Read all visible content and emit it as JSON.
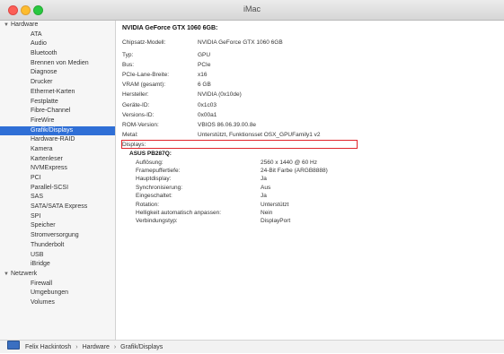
{
  "window": {
    "title": "iMac"
  },
  "sidebar": {
    "items": [
      {
        "type": "group",
        "label": "Hardware",
        "expanded": true
      },
      {
        "type": "item",
        "label": "ATA"
      },
      {
        "type": "item",
        "label": "Audio"
      },
      {
        "type": "item",
        "label": "Bluetooth"
      },
      {
        "type": "item",
        "label": "Brennen von Medien"
      },
      {
        "type": "item",
        "label": "Diagnose"
      },
      {
        "type": "item",
        "label": "Drucker"
      },
      {
        "type": "item",
        "label": "Ethernet-Karten"
      },
      {
        "type": "item",
        "label": "Festplatte"
      },
      {
        "type": "item",
        "label": "Fibre-Channel"
      },
      {
        "type": "item",
        "label": "FireWire"
      },
      {
        "type": "item",
        "label": "Grafik/Displays",
        "selected": true
      },
      {
        "type": "item",
        "label": "Hardware-RAID"
      },
      {
        "type": "item",
        "label": "Kamera"
      },
      {
        "type": "item",
        "label": "Kartenleser"
      },
      {
        "type": "item",
        "label": "NVMExpress"
      },
      {
        "type": "item",
        "label": "PCI"
      },
      {
        "type": "item",
        "label": "Parallel-SCSI"
      },
      {
        "type": "item",
        "label": "SAS"
      },
      {
        "type": "item",
        "label": "SATA/SATA Express"
      },
      {
        "type": "item",
        "label": "SPI"
      },
      {
        "type": "item",
        "label": "Speicher"
      },
      {
        "type": "item",
        "label": "Stromversorgung"
      },
      {
        "type": "item",
        "label": "Thunderbolt"
      },
      {
        "type": "item",
        "label": "USB"
      },
      {
        "type": "item",
        "label": "iBridge"
      },
      {
        "type": "group",
        "label": "Netzwerk",
        "expanded": true
      },
      {
        "type": "item",
        "label": "Firewall"
      },
      {
        "type": "item",
        "label": "Umgebungen"
      },
      {
        "type": "item",
        "label": "Volumes"
      }
    ]
  },
  "detail": {
    "heading": "NVIDIA GeForce GTX 1060 6GB:",
    "properties": [
      {
        "key": "Chipsatz-Modell:",
        "value": "NVIDIA GeForce GTX 1060 6GB"
      },
      {
        "key": "Typ:",
        "value": "GPU"
      },
      {
        "key": "Bus:",
        "value": "PCIe"
      },
      {
        "key": "PCIe-Lane-Breite:",
        "value": "x16"
      },
      {
        "key": "VRAM (gesamt):",
        "value": "6 GB"
      },
      {
        "key": "Hersteller:",
        "value": "NVIDIA (0x10de)"
      },
      {
        "key": "Geräte-ID:",
        "value": "0x1c03"
      },
      {
        "key": "Versions-ID:",
        "value": "0x00a1"
      },
      {
        "key": "ROM-Version:",
        "value": "VBIOS 86.06.39.00.8e"
      },
      {
        "key": "Metal:",
        "value": "Unterstützt, Funktionsset OSX_GPUFamily1 v2",
        "highlighted": true
      },
      {
        "key": "Displays:",
        "value": ""
      }
    ],
    "display": {
      "name": "ASUS PB287Q:",
      "properties": [
        {
          "key": "Auflösung:",
          "value": "2560 x 1440 @ 60 Hz"
        },
        {
          "key": "Framepuffertiefe:",
          "value": "24-Bit Farbe (ARGB8888)"
        },
        {
          "key": "Hauptdisplay:",
          "value": "Ja"
        },
        {
          "key": "Synchronisierung:",
          "value": "Aus"
        },
        {
          "key": "Eingeschaltet:",
          "value": "Ja"
        },
        {
          "key": "Rotation:",
          "value": "Unterstützt"
        },
        {
          "key": "Helligkeit automatisch anpassen:",
          "value": "Nein"
        },
        {
          "key": "Verbindungstyp:",
          "value": "DisplayPort"
        }
      ]
    }
  },
  "statusbar": {
    "path": [
      "Felix Hackintosh",
      "Hardware",
      "Grafik/Displays"
    ],
    "separator": "›"
  },
  "colors": {
    "selection": "#2f6fd6",
    "highlight_border": "#e0242a"
  }
}
